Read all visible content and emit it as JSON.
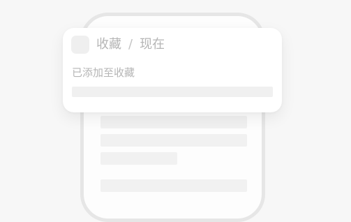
{
  "notification": {
    "app_name": "收藏",
    "separator": "/",
    "time": "现在",
    "message": "已添加至收藏"
  }
}
